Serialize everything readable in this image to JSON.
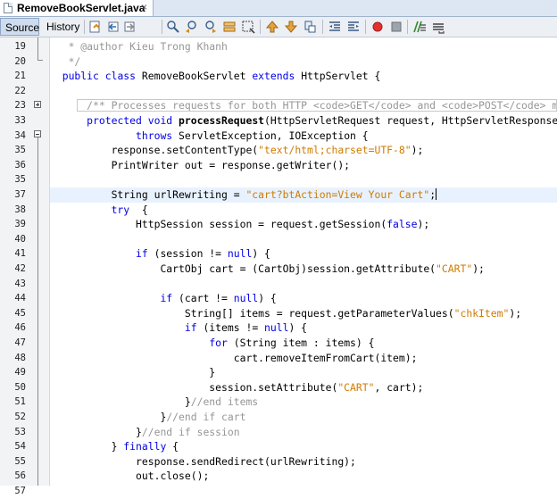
{
  "tab": {
    "title": "RemoveBookServlet.java",
    "close": "×"
  },
  "toolbar": {
    "source_label": "Source",
    "history_label": "History",
    "icons": [
      "last-edit-icon",
      "back-icon",
      "forward-icon",
      "find-selection-icon",
      "find-previous-icon",
      "find-next-icon",
      "toggle-highlight-icon",
      "toggle-rect-select-icon",
      "previous-bookmark-icon",
      "next-bookmark-icon",
      "toggle-bookmark-icon",
      "shift-left-icon",
      "shift-right-icon",
      "start-macro-icon",
      "stop-macro-icon",
      "comment-icon",
      "uncomment-icon"
    ]
  },
  "colors": {
    "keyword": "#0000e6",
    "string": "#ce7b00",
    "comment": "#969696",
    "current_line": "#e8f2fe"
  },
  "lines": [
    {
      "num": "19",
      "tokens": [
        {
          "t": "   * @author Kieu Trong Khanh",
          "c": "c"
        }
      ]
    },
    {
      "num": "20",
      "tokens": [
        {
          "t": "   */",
          "c": "c"
        }
      ]
    },
    {
      "num": "21",
      "tokens": [
        {
          "t": "  ",
          "c": ""
        },
        {
          "t": "public class",
          "c": "k"
        },
        {
          "t": " RemoveBookServlet ",
          "c": ""
        },
        {
          "t": "extends",
          "c": "k"
        },
        {
          "t": " HttpServlet {",
          "c": ""
        }
      ]
    },
    {
      "num": "22",
      "tokens": [
        {
          "t": "",
          "c": ""
        }
      ]
    },
    {
      "num": "23",
      "tokens": [
        {
          "t": "      /** Processes requests for both HTTP <code>GET</code> and <code>POST</code> methods.",
          "c": "c"
        }
      ]
    },
    {
      "num": "33",
      "tokens": [
        {
          "t": "      ",
          "c": ""
        },
        {
          "t": "protected void",
          "c": "k"
        },
        {
          "t": " ",
          "c": ""
        },
        {
          "t": "processRequest",
          "c": "m"
        },
        {
          "t": "(HttpServletRequest request, HttpServletResponse response)",
          "c": ""
        }
      ]
    },
    {
      "num": "34",
      "tokens": [
        {
          "t": "              ",
          "c": ""
        },
        {
          "t": "throws",
          "c": "k"
        },
        {
          "t": " ServletException, IOException {",
          "c": ""
        }
      ]
    },
    {
      "num": "35",
      "tokens": [
        {
          "t": "          response.setContentType(",
          "c": ""
        },
        {
          "t": "\"text/html;charset=UTF-8\"",
          "c": "s"
        },
        {
          "t": ");",
          "c": ""
        }
      ]
    },
    {
      "num": "36",
      "tokens": [
        {
          "t": "          PrintWriter out = response.getWriter();",
          "c": ""
        }
      ]
    },
    {
      "num": "35",
      "tokens": [
        {
          "t": "",
          "c": ""
        }
      ]
    },
    {
      "num": "37",
      "current": true,
      "caret": true,
      "tokens": [
        {
          "t": "          String urlRewriting = ",
          "c": ""
        },
        {
          "t": "\"cart?btAction=View Your Cart\"",
          "c": "s"
        },
        {
          "t": ";",
          "c": ""
        }
      ]
    },
    {
      "num": "38",
      "tokens": [
        {
          "t": "          ",
          "c": ""
        },
        {
          "t": "try",
          "c": "k"
        },
        {
          "t": "  {",
          "c": ""
        }
      ]
    },
    {
      "num": "39",
      "tokens": [
        {
          "t": "              HttpSession session = request.getSession(",
          "c": ""
        },
        {
          "t": "false",
          "c": "k"
        },
        {
          "t": ");",
          "c": ""
        }
      ]
    },
    {
      "num": "40",
      "tokens": [
        {
          "t": "",
          "c": ""
        }
      ]
    },
    {
      "num": "41",
      "tokens": [
        {
          "t": "              ",
          "c": ""
        },
        {
          "t": "if",
          "c": "k"
        },
        {
          "t": " (session != ",
          "c": ""
        },
        {
          "t": "null",
          "c": "k"
        },
        {
          "t": ") {",
          "c": ""
        }
      ]
    },
    {
      "num": "42",
      "tokens": [
        {
          "t": "                  CartObj cart = (CartObj)session.getAttribute(",
          "c": ""
        },
        {
          "t": "\"CART\"",
          "c": "s"
        },
        {
          "t": ");",
          "c": ""
        }
      ]
    },
    {
      "num": "43",
      "tokens": [
        {
          "t": "",
          "c": ""
        }
      ]
    },
    {
      "num": "44",
      "tokens": [
        {
          "t": "                  ",
          "c": ""
        },
        {
          "t": "if",
          "c": "k"
        },
        {
          "t": " (cart != ",
          "c": ""
        },
        {
          "t": "null",
          "c": "k"
        },
        {
          "t": ") {",
          "c": ""
        }
      ]
    },
    {
      "num": "45",
      "tokens": [
        {
          "t": "                      String[] items = request.getParameterValues(",
          "c": ""
        },
        {
          "t": "\"chkItem\"",
          "c": "s"
        },
        {
          "t": ");",
          "c": ""
        }
      ]
    },
    {
      "num": "46",
      "tokens": [
        {
          "t": "                      ",
          "c": ""
        },
        {
          "t": "if",
          "c": "k"
        },
        {
          "t": " (items != ",
          "c": ""
        },
        {
          "t": "null",
          "c": "k"
        },
        {
          "t": ") {",
          "c": ""
        }
      ]
    },
    {
      "num": "47",
      "tokens": [
        {
          "t": "                          ",
          "c": ""
        },
        {
          "t": "for",
          "c": "k"
        },
        {
          "t": " (String item : items) {",
          "c": ""
        }
      ]
    },
    {
      "num": "48",
      "tokens": [
        {
          "t": "                              cart.removeItemFromCart(item);",
          "c": ""
        }
      ]
    },
    {
      "num": "49",
      "tokens": [
        {
          "t": "                          }",
          "c": ""
        }
      ]
    },
    {
      "num": "50",
      "tokens": [
        {
          "t": "                          session.setAttribute(",
          "c": ""
        },
        {
          "t": "\"CART\"",
          "c": "s"
        },
        {
          "t": ", cart);",
          "c": ""
        }
      ]
    },
    {
      "num": "51",
      "tokens": [
        {
          "t": "                      }",
          "c": ""
        },
        {
          "t": "//end items",
          "c": "c"
        }
      ]
    },
    {
      "num": "52",
      "tokens": [
        {
          "t": "                  }",
          "c": ""
        },
        {
          "t": "//end if cart",
          "c": "c"
        }
      ]
    },
    {
      "num": "53",
      "tokens": [
        {
          "t": "              }",
          "c": ""
        },
        {
          "t": "//end if session",
          "c": "c"
        }
      ]
    },
    {
      "num": "54",
      "tokens": [
        {
          "t": "          } ",
          "c": ""
        },
        {
          "t": "finally",
          "c": "k"
        },
        {
          "t": " {",
          "c": ""
        }
      ]
    },
    {
      "num": "55",
      "tokens": [
        {
          "t": "              response.sendRedirect(urlRewriting);",
          "c": ""
        }
      ]
    },
    {
      "num": "56",
      "tokens": [
        {
          "t": "              out.close();",
          "c": ""
        }
      ]
    },
    {
      "num": "57",
      "tokens": [
        {
          "t": "          }",
          "c": ""
        }
      ]
    }
  ]
}
